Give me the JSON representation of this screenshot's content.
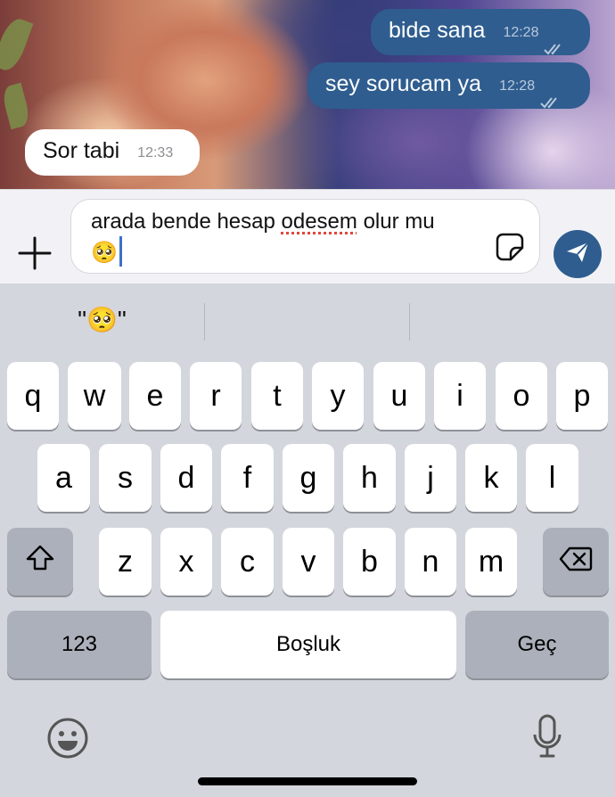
{
  "chat": {
    "messages": [
      {
        "direction": "out",
        "text": "bide sana",
        "time": "12:28",
        "status": "read"
      },
      {
        "direction": "out",
        "text": "sey sorucam ya",
        "time": "12:28",
        "status": "read"
      },
      {
        "direction": "in",
        "text": "Sor tabi",
        "time": "12:33"
      }
    ]
  },
  "compose": {
    "text_before": "arada bende hesap ",
    "misspelled_word": "odesem",
    "text_after": " olur mu",
    "emoji": "🥺",
    "plus_icon": "plus-icon",
    "sticker_icon": "sticker-icon",
    "send_icon": "send-arrow-icon",
    "accent_color": "#2f5d8f"
  },
  "keyboard": {
    "suggestions": [
      "\"🥺\"",
      "",
      ""
    ],
    "row1": [
      "q",
      "w",
      "e",
      "r",
      "t",
      "y",
      "u",
      "i",
      "o",
      "p"
    ],
    "row2": [
      "a",
      "s",
      "d",
      "f",
      "g",
      "h",
      "j",
      "k",
      "l"
    ],
    "row3": [
      "z",
      "x",
      "c",
      "v",
      "b",
      "n",
      "m"
    ],
    "numbers_label": "123",
    "space_label": "Boşluk",
    "return_label": "Geç",
    "shift_icon": "shift-icon",
    "delete_icon": "backspace-icon",
    "emoji_icon": "emoji-icon",
    "mic_icon": "microphone-icon"
  }
}
